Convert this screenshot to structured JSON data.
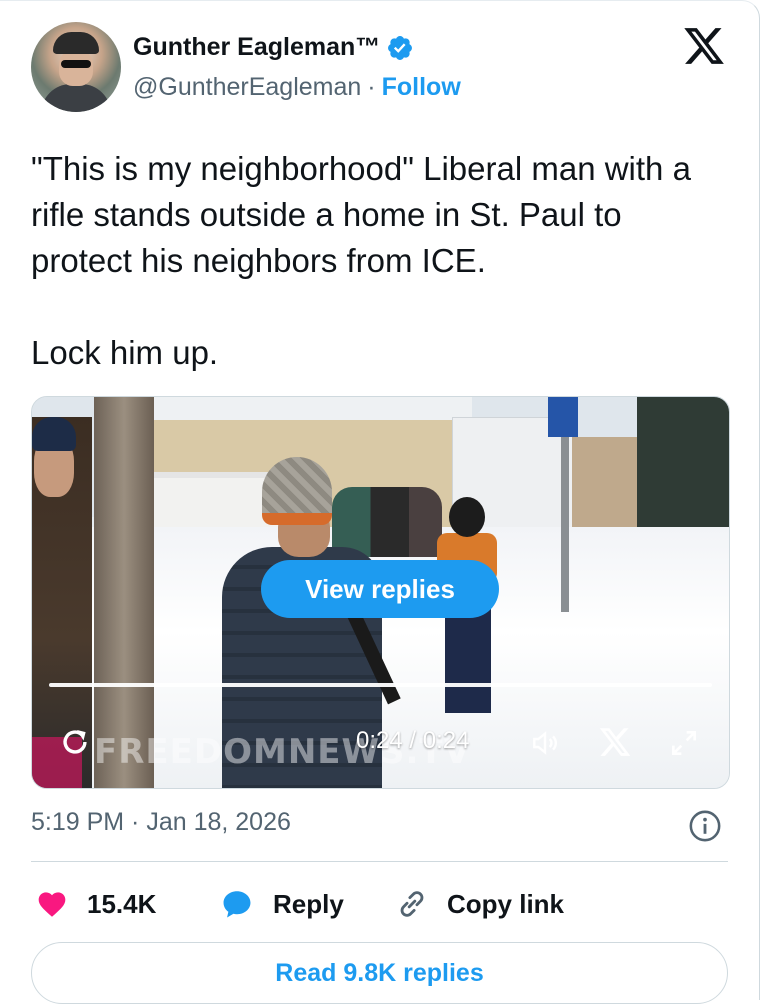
{
  "author": {
    "display_name": "Gunther Eagleman™",
    "handle": "@GuntherEagleman",
    "separator": "·",
    "follow_label": "Follow",
    "verified": true
  },
  "tweet": {
    "text": "\"This is my neighborhood\" Liberal man with a rifle stands outside a home in St. Paul to protect his neighbors from ICE.\n\nLock him up.",
    "timestamp": "5:19 PM · Jan 18, 2026"
  },
  "media": {
    "view_replies_label": "View replies",
    "watermark": "FREEDOMNEWS.TV",
    "time": "0:24 / 0:24",
    "progress": 1.0
  },
  "actions": {
    "likes": "15.4K",
    "reply_label": "Reply",
    "copy_link_label": "Copy link"
  },
  "read_replies_label": "Read 9.8K replies",
  "colors": {
    "accent": "#1d9bf0",
    "like": "#f91880",
    "secondary_text": "#536471"
  }
}
